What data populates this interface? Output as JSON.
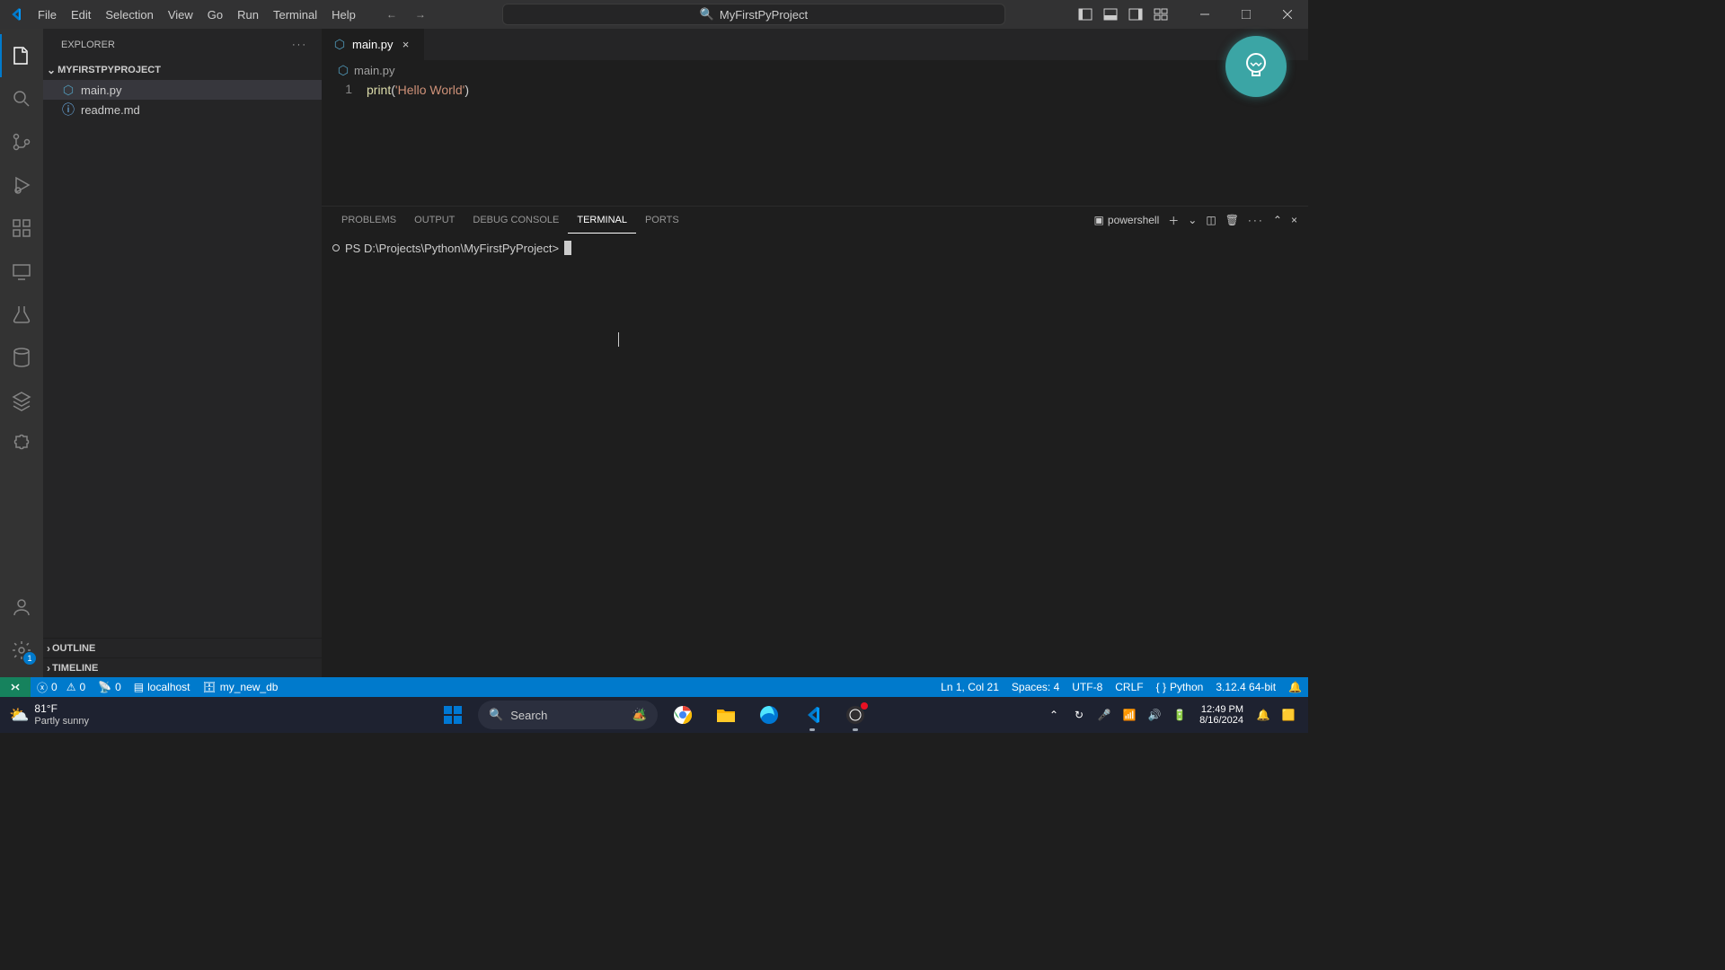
{
  "titlebar": {
    "menus": [
      "File",
      "Edit",
      "Selection",
      "View",
      "Go",
      "Run",
      "Terminal",
      "Help"
    ],
    "search": "MyFirstPyProject"
  },
  "sidebar": {
    "title": "EXPLORER",
    "folder": "MYFIRSTPYPROJECT",
    "files": [
      {
        "name": "main.py",
        "icon": "py",
        "selected": true
      },
      {
        "name": "readme.md",
        "icon": "info",
        "selected": false
      }
    ],
    "outline": "OUTLINE",
    "timeline": "TIMELINE"
  },
  "editor": {
    "tab": "main.py",
    "breadcrumb": "main.py",
    "line_no": "1",
    "code": {
      "fn": "print",
      "open": "(",
      "str": "'Hello World'",
      "close": ")"
    }
  },
  "panel": {
    "tabs": [
      "PROBLEMS",
      "OUTPUT",
      "DEBUG CONSOLE",
      "TERMINAL",
      "PORTS"
    ],
    "active_tab": 3,
    "shell": "powershell",
    "prompt": "PS D:\\Projects\\Python\\MyFirstPyProject>"
  },
  "status": {
    "errors": "0",
    "warnings": "0",
    "ports": "0",
    "localhost": "localhost",
    "db": "my_new_db",
    "cursor": "Ln 1, Col 21",
    "spaces": "Spaces: 4",
    "encoding": "UTF-8",
    "eol": "CRLF",
    "lang": "Python",
    "version": "3.12.4 64-bit"
  },
  "taskbar": {
    "temp": "81°F",
    "cond": "Partly sunny",
    "search": "Search",
    "time": "12:49 PM",
    "date": "8/16/2024"
  },
  "gear_badge": "1"
}
